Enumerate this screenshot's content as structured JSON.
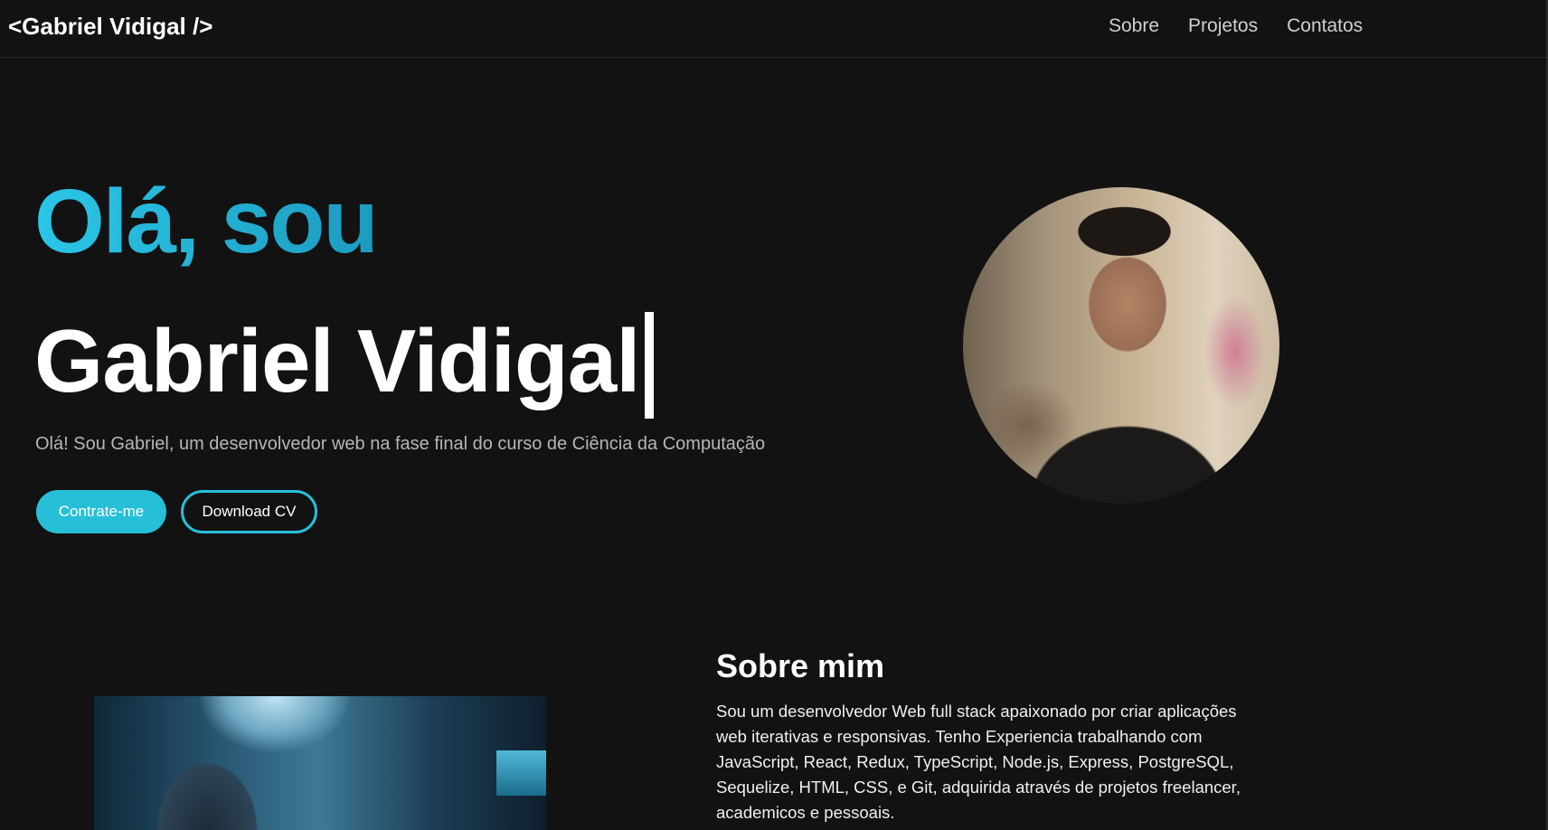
{
  "nav": {
    "logo": "<Gabriel Vidigal />",
    "links": [
      "Sobre",
      "Projetos",
      "Contatos"
    ]
  },
  "hero": {
    "greeting": "Olá, sou",
    "name": "Gabriel Vidigal",
    "intro": "Olá! Sou Gabriel, um desenvolvedor web na fase final do curso de Ciência da Computação",
    "primary_button": "Contrate-me",
    "secondary_button": "Download CV"
  },
  "about": {
    "title": "Sobre mim",
    "text": "Sou um desenvolvedor Web full stack apaixonado por criar aplicações web iterativas e responsivas. Tenho Experiencia trabalhando com JavaScript, React, Redux, TypeScript, Node.js, Express, PostgreSQL, Sequelize, HTML, CSS, e Git, adquirida através de projetos freelancer, academicos e pessoais."
  },
  "colors": {
    "background": "#121212",
    "accent": "#26bfd8",
    "text": "#ffffff"
  }
}
